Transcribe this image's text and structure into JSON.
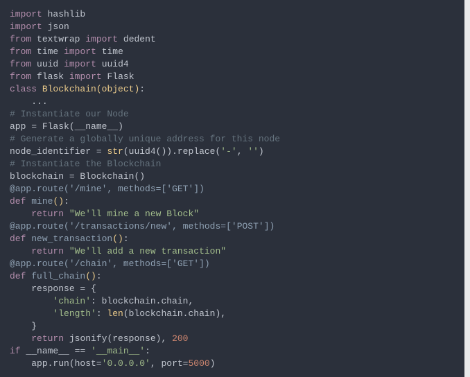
{
  "code": {
    "l1": {
      "kw1": "import",
      "m": "hashlib"
    },
    "l2": {
      "kw1": "import",
      "m": "json"
    },
    "l3": {
      "kw1": "from",
      "m": "textwrap",
      "kw2": "import",
      "n": "dedent"
    },
    "l4": {
      "kw1": "from",
      "m": "time",
      "kw2": "import",
      "n": "time"
    },
    "l5": {
      "kw1": "from",
      "m": "uuid",
      "kw2": "import",
      "n": "uuid4"
    },
    "l6": {
      "kw1": "from",
      "m": "flask",
      "kw2": "import",
      "n": "Flask"
    },
    "l7": {
      "kw": "class",
      "cls": "Blockchain",
      "base": "object"
    },
    "l8": {
      "ellipsis": "..."
    },
    "l9": {
      "cmt": "# Instantiate our Node"
    },
    "l10": {
      "app": "app",
      "eq": " = ",
      "fn": "Flask",
      "arg": "__name__"
    },
    "l11": {
      "cmt": "# Generate a globally unique address for this node"
    },
    "l12": {
      "lhs": "node_identifier",
      "eq": " = ",
      "str_fn": "str",
      "uuid": "uuid4",
      "replace": ".replace(",
      "s1": "'-'",
      "c": ", ",
      "s2": "''",
      "close": ")"
    },
    "l13": {
      "cmt": "# Instantiate the Blockchain"
    },
    "l14": {
      "lhs": "blockchain",
      "eq": " = ",
      "cls": "Blockchain"
    },
    "l15": {
      "deco": "@app.route(",
      "route": "'/mine'",
      "mid": ", methods=[",
      "method": "'GET'",
      "end": "])"
    },
    "l16": {
      "kw": "def",
      "fn": "mine"
    },
    "l17": {
      "kw": "return",
      "s": "\"We'll mine a new Block\""
    },
    "l18": {
      "deco": "@app.route(",
      "route": "'/transactions/new'",
      "mid": ", methods=[",
      "method": "'POST'",
      "end": "])"
    },
    "l19": {
      "kw": "def",
      "fn": "new_transaction"
    },
    "l20": {
      "kw": "return",
      "s": "\"We'll add a new transaction\""
    },
    "l21": {
      "deco": "@app.route(",
      "route": "'/chain'",
      "mid": ", methods=[",
      "method": "'GET'",
      "end": "])"
    },
    "l22": {
      "kw": "def",
      "fn": "full_chain"
    },
    "l23": {
      "txt": "response = {"
    },
    "l24": {
      "key": "'chain'",
      "val": ": blockchain.chain,"
    },
    "l25": {
      "key": "'length'",
      "pre": ": ",
      "len": "len",
      "arg": "(blockchain.chain),"
    },
    "l26": {
      "brace": "}"
    },
    "l27": {
      "kw": "return",
      "fn": "jsonify",
      "arg": "(response), ",
      "num": "200"
    },
    "l28": {
      "kw": "if",
      "lhs": "__name__",
      "eq": " == ",
      "rhs": "'__main__'",
      "colon": ":"
    },
    "l29": {
      "obj": "app.run(host=",
      "host": "'0.0.0.0'",
      "mid": ", port=",
      "port": "5000",
      "end": ")"
    }
  }
}
